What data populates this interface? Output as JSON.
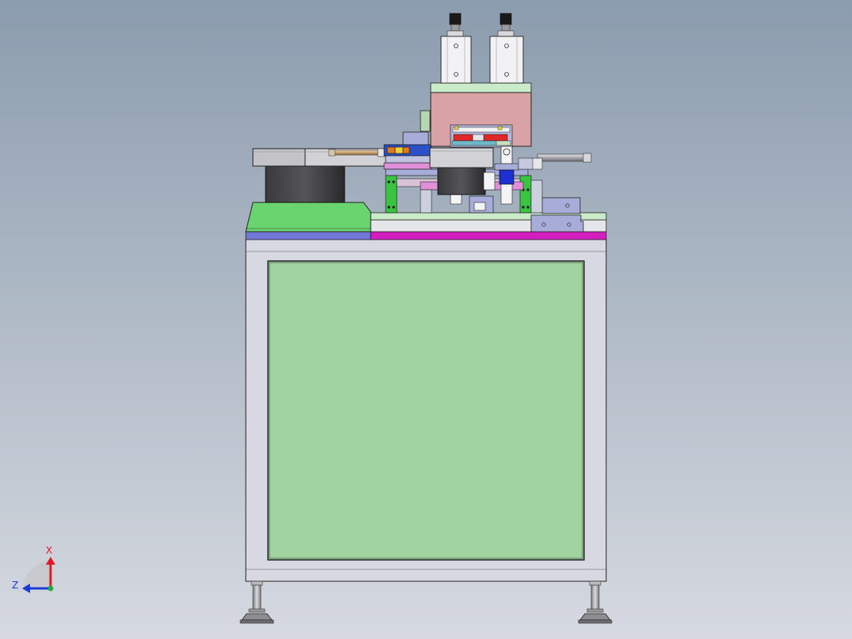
{
  "triad": {
    "x_label": "X",
    "z_label": "Z",
    "x_color": "#e0182a",
    "z_color": "#1b3bd6",
    "y_color": "#23a845"
  },
  "colors": {
    "background_top": "#8b9cae",
    "background_bottom": "#d6d9e0",
    "frame": "#d8d8e2",
    "panel": "#a0d3a0",
    "bowl_dark": "#2d2d2f",
    "cylinder_body": "#f2f2f5",
    "pink_block": "#d9a3a5",
    "base_green": "#6ad46f",
    "magenta_strip": "#d41fbf",
    "blue_strip": "#7178d8"
  }
}
